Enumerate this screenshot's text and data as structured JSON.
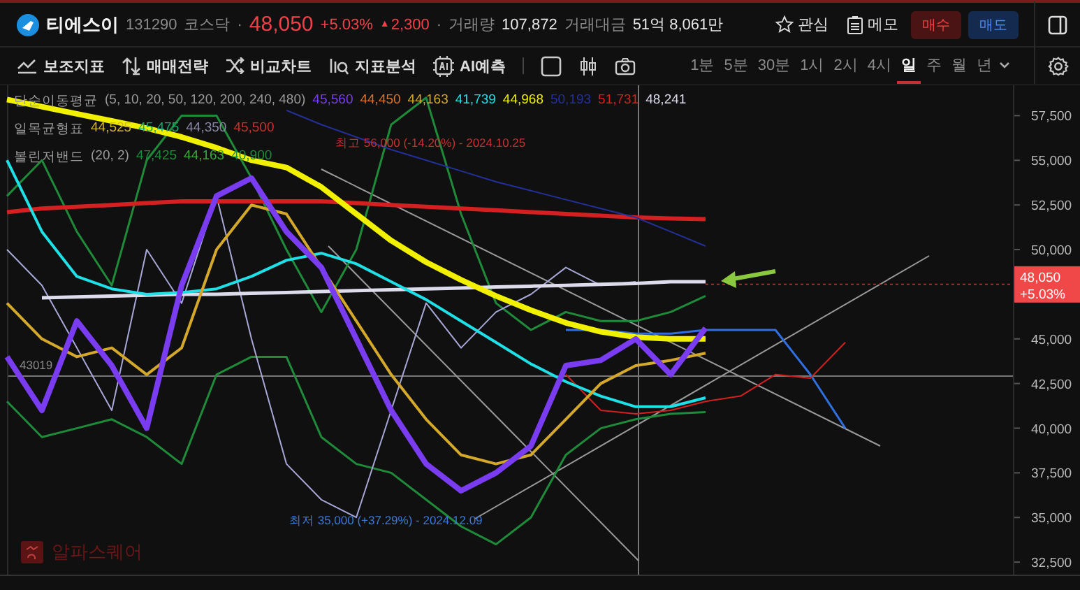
{
  "header": {
    "name": "티에스이",
    "code": "131290",
    "market": "코스닥",
    "separator": "·",
    "price": "48,050",
    "change_pct": "+5.03%",
    "change_arrow": "▲",
    "change": "2,300",
    "separator_2": "·",
    "volume_label": "거래량",
    "volume": "107,872",
    "amount_label": "거래대금",
    "amount": "51억 8,061만",
    "watch": "관심",
    "memo": "메모",
    "buy": "매수",
    "sell": "매도"
  },
  "toolbar": {
    "tools": [
      {
        "kind": "indicator",
        "label": "보조지표"
      },
      {
        "kind": "strategy",
        "label": "매매전략"
      },
      {
        "kind": "compare",
        "label": "비교차트"
      },
      {
        "kind": "analysis",
        "label": "지표분석"
      },
      {
        "kind": "ai",
        "label": "AI예측"
      }
    ],
    "periods": [
      {
        "label": "1분",
        "selected": false
      },
      {
        "label": "5분",
        "selected": false
      },
      {
        "label": "30분",
        "selected": false
      },
      {
        "label": "1시",
        "selected": false
      },
      {
        "label": "2시",
        "selected": false
      },
      {
        "label": "4시",
        "selected": false
      },
      {
        "label": "일",
        "selected": true
      },
      {
        "label": "주",
        "selected": false
      },
      {
        "label": "월",
        "selected": false
      },
      {
        "label": "년",
        "selected": false
      }
    ]
  },
  "legends": [
    {
      "label": "단순이동평균",
      "params": "(5, 10, 20, 50, 120, 200, 240, 480)",
      "values": [
        {
          "text": "45,560",
          "color": "#7a3cf0"
        },
        {
          "text": "44,450",
          "color": "#d8742c"
        },
        {
          "text": "44,163",
          "color": "#d4a82a"
        },
        {
          "text": "41,739",
          "color": "#1ee0e6"
        },
        {
          "text": "44,968",
          "color": "#f0f000"
        },
        {
          "text": "50,193",
          "color": "#23309a"
        },
        {
          "text": "51,731",
          "color": "#d42020"
        },
        {
          "text": "48,241",
          "color": "#dcdcec"
        }
      ]
    },
    {
      "label": "일목균형표",
      "values": [
        {
          "text": "44,525",
          "color": "#d4b82a"
        },
        {
          "text": "45,475",
          "color": "#1aa86a"
        },
        {
          "text": "44,350",
          "color": "#8a8aa8"
        },
        {
          "text": "45,500",
          "color": "#c83030"
        }
      ]
    },
    {
      "label": "볼린저밴드",
      "params": "(20, 2)",
      "values": [
        {
          "text": "47,425",
          "color": "#1f8a3a"
        },
        {
          "text": "44,163",
          "color": "#3aa83a"
        },
        {
          "text": "40,900",
          "color": "#1f8a3a"
        }
      ]
    }
  ],
  "chart": {
    "axis_labels": [
      "57,500",
      "55,000",
      "52,500",
      "50,000",
      "45,000",
      "42,500",
      "40,000",
      "37,500",
      "35,000",
      "32,500"
    ],
    "notes": [
      {
        "kind": "high",
        "text": "최고 56,000 (-14.20%) - 2024.10.25",
        "color": "#c83030"
      },
      {
        "kind": "low",
        "text": "최저 35,000 (+37.29%) - 2024.12.09",
        "color": "#3a7ad8"
      },
      {
        "kind": "crosshair",
        "text": "43019",
        "color": "#8a8a8a"
      }
    ],
    "price_tag": {
      "price": "48,050",
      "change": "+5.03%"
    },
    "brand": "알파스퀘어"
  }
}
